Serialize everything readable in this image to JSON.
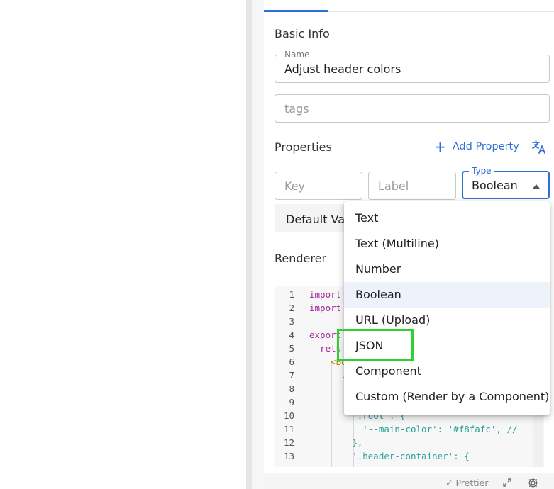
{
  "basic_info": {
    "section_title": "Basic Info",
    "name_label": "Name",
    "name_value": "Adjust header colors",
    "tags_placeholder": "tags"
  },
  "properties": {
    "section_title": "Properties",
    "add_property_label": "Add Property",
    "key_placeholder": "Key",
    "label_placeholder": "Label",
    "type_label": "Type",
    "type_value": "Boolean",
    "default_value_text": "Default Val"
  },
  "renderer": {
    "section_title": "Renderer",
    "code_lines": [
      {
        "n": "1",
        "text": "import"
      },
      {
        "n": "2",
        "text": "import"
      },
      {
        "n": "3",
        "text": ""
      },
      {
        "n": "4",
        "text": "export"
      },
      {
        "n": "5",
        "text": "  retu"
      },
      {
        "n": "6",
        "text": "    <Bo"
      },
      {
        "n": "7",
        "text": "      ."
      },
      {
        "n": "8",
        "text": ""
      },
      {
        "n": "9",
        "text": ""
      },
      {
        "n": "10",
        "text": "        ':root': {"
      },
      {
        "n": "11",
        "text": "          '--main-color': '#f8fafc', //"
      },
      {
        "n": "12",
        "text": "        },"
      },
      {
        "n": "13",
        "text": "        '.header-container': {"
      }
    ]
  },
  "footer": {
    "prettier_label": "Prettier"
  },
  "type_dropdown": {
    "options": [
      "Text",
      "Text (Multiline)",
      "Number",
      "Boolean",
      "URL (Upload)",
      "JSON",
      "Component",
      "Custom (Render by a Component)"
    ],
    "selected": "Boolean",
    "highlighted": "JSON"
  },
  "colors": {
    "accent": "#2f6fd6",
    "highlight_box": "#2ed12e"
  }
}
